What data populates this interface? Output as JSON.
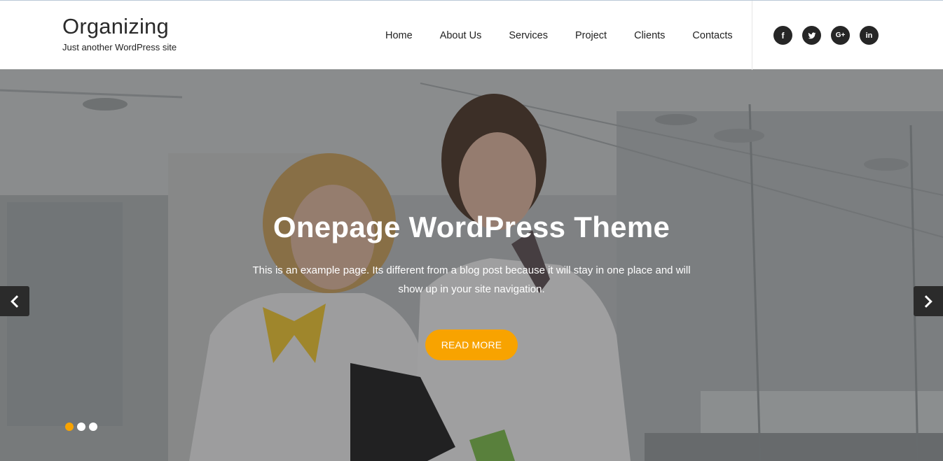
{
  "site": {
    "title": "Organizing",
    "tagline": "Just another WordPress site"
  },
  "nav": {
    "items": [
      {
        "label": "Home"
      },
      {
        "label": "About Us"
      },
      {
        "label": "Services"
      },
      {
        "label": "Project"
      },
      {
        "label": "Clients"
      },
      {
        "label": "Contacts"
      }
    ]
  },
  "social": {
    "items": [
      {
        "name": "facebook",
        "icon": "facebook-icon",
        "glyph": "f"
      },
      {
        "name": "twitter",
        "icon": "twitter-icon",
        "glyph": ""
      },
      {
        "name": "google-plus",
        "icon": "google-plus-icon",
        "glyph": "G+"
      },
      {
        "name": "linkedin",
        "icon": "linkedin-icon",
        "glyph": "in"
      }
    ]
  },
  "hero": {
    "title": "Onepage WordPress Theme",
    "text": "This is an example page. Its different from a blog post because it will stay in one place and will show up in your site navigation.",
    "button_label": "Read More",
    "slides_total": 3,
    "active_slide": 1,
    "prev_icon": "chevron-left-icon",
    "next_icon": "chevron-right-icon"
  },
  "colors": {
    "accent": "#f8a300",
    "dark": "#262626",
    "header_bg": "#ffffff"
  }
}
